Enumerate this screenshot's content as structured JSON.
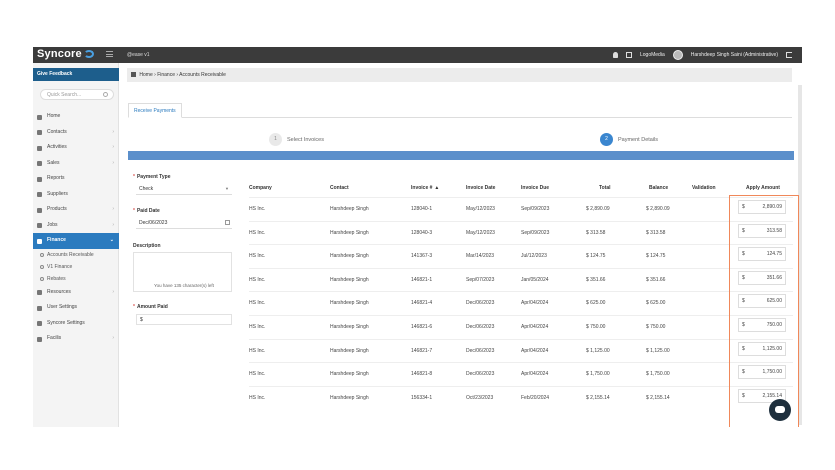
{
  "topbar": {
    "app_name": "Syncore",
    "instance": "@ease v1",
    "company": "LogoMedia",
    "user": "Harshdeep Singh Saini (Administrative)"
  },
  "sidebar": {
    "feedback_label": "Give Feedback",
    "search_placeholder": "Quick Search...",
    "items": [
      {
        "label": "Home",
        "icon": "home-icon",
        "chevron": false
      },
      {
        "label": "Contacts",
        "icon": "users-icon",
        "chevron": true
      },
      {
        "label": "Activities",
        "icon": "calendar-icon",
        "chevron": true
      },
      {
        "label": "Sales",
        "icon": "dollar-icon",
        "chevron": true
      },
      {
        "label": "Reports",
        "icon": "report-icon",
        "chevron": false
      },
      {
        "label": "Suppliers",
        "icon": "truck-icon",
        "chevron": false
      },
      {
        "label": "Products",
        "icon": "box-icon",
        "chevron": true
      },
      {
        "label": "Jobs",
        "icon": "briefcase-icon",
        "chevron": true
      },
      {
        "label": "Finance",
        "icon": "finance-icon",
        "chevron": true,
        "active": true
      }
    ],
    "finance_sub": [
      {
        "label": "Accounts Receivable",
        "icon": "circle-icon"
      },
      {
        "label": "V1 Finance",
        "icon": "circle-icon"
      },
      {
        "label": "Rebates",
        "icon": "percent-icon"
      }
    ],
    "items_after": [
      {
        "label": "Resources",
        "icon": "folder-icon",
        "chevron": true
      },
      {
        "label": "User Settings",
        "icon": "user-icon",
        "chevron": false
      },
      {
        "label": "Syncore Settings",
        "icon": "settings-icon",
        "chevron": false
      },
      {
        "label": "Facilis",
        "icon": "gear-icon",
        "chevron": true
      }
    ]
  },
  "breadcrumb": [
    "Home",
    "Finance",
    "Accounts Receivable"
  ],
  "tab": "Receive Payments",
  "steps": [
    {
      "num": "1",
      "label": "Select Invoices"
    },
    {
      "num": "2",
      "label": "Payment Details"
    }
  ],
  "form": {
    "payment_type_label": "Payment Type",
    "payment_type_value": "Check",
    "paid_date_label": "Paid Date",
    "paid_date_value": "Dec/06/2023",
    "description_label": "Description",
    "description_hint": "You have 135 character(s) left",
    "amount_paid_label": "Amount Paid",
    "amount_paid_currency": "$"
  },
  "table": {
    "headers": [
      "Company",
      "Contact",
      "Invoice #",
      "Invoice Date",
      "Invoice Due",
      "Total",
      "Balance",
      "Validation",
      "Apply Amount"
    ],
    "sort_indicator": "▲",
    "currency": "$",
    "rows": [
      {
        "company": "HS Inc.",
        "contact": "Harshdeep Singh",
        "invoice": "128040-1",
        "date": "May/12/2023",
        "due": "Sep/09/2023",
        "total": "$ 2,890.09",
        "balance": "$ 2,890.09",
        "apply": "2,890.09"
      },
      {
        "company": "HS Inc.",
        "contact": "Harshdeep Singh",
        "invoice": "128040-3",
        "date": "May/12/2023",
        "due": "Sep/09/2023",
        "total": "$ 313.58",
        "balance": "$ 313.58",
        "apply": "313.58"
      },
      {
        "company": "HS Inc.",
        "contact": "Harshdeep Singh",
        "invoice": "141367-3",
        "date": "Mar/14/2023",
        "due": "Jul/12/2023",
        "total": "$ 124.75",
        "balance": "$ 124.75",
        "apply": "124.75"
      },
      {
        "company": "HS Inc.",
        "contact": "Harshdeep Singh",
        "invoice": "146821-1",
        "date": "Sep/07/2023",
        "due": "Jan/05/2024",
        "total": "$ 351.66",
        "balance": "$ 351.66",
        "apply": "351.66"
      },
      {
        "company": "HS Inc.",
        "contact": "Harshdeep Singh",
        "invoice": "146821-4",
        "date": "Dec/06/2023",
        "due": "Apr/04/2024",
        "total": "$ 625.00",
        "balance": "$ 625.00",
        "apply": "625.00"
      },
      {
        "company": "HS Inc.",
        "contact": "Harshdeep Singh",
        "invoice": "146821-6",
        "date": "Dec/06/2023",
        "due": "Apr/04/2024",
        "total": "$ 750.00",
        "balance": "$ 750.00",
        "apply": "750.00"
      },
      {
        "company": "HS Inc.",
        "contact": "Harshdeep Singh",
        "invoice": "146821-7",
        "date": "Dec/06/2023",
        "due": "Apr/04/2024",
        "total": "$ 1,125.00",
        "balance": "$ 1,125.00",
        "apply": "1,125.00"
      },
      {
        "company": "HS Inc.",
        "contact": "Harshdeep Singh",
        "invoice": "146821-8",
        "date": "Dec/06/2023",
        "due": "Apr/04/2024",
        "total": "$ 1,750.00",
        "balance": "$ 1,750.00",
        "apply": "1,750.00"
      },
      {
        "company": "HS Inc.",
        "contact": "Harshdeep Singh",
        "invoice": "156334-1",
        "date": "Oct/23/2023",
        "due": "Feb/20/2024",
        "total": "$ 2,155.14",
        "balance": "$ 2,155.14",
        "apply": "2,155.14"
      }
    ]
  }
}
